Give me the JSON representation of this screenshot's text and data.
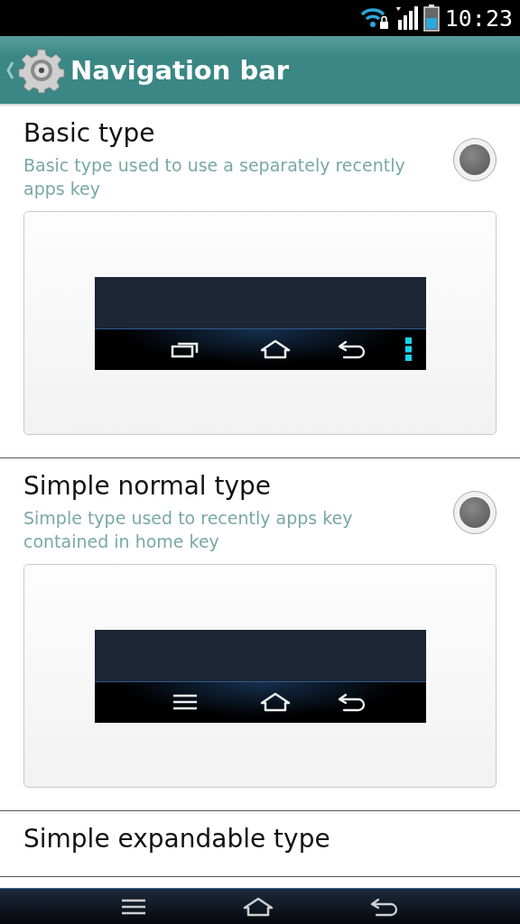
{
  "status_bar": {
    "time": "10:23"
  },
  "action_bar": {
    "title": "Navigation bar"
  },
  "options": [
    {
      "title": "Basic type",
      "description": "Basic type used to use a separately recently apps key",
      "selected": false,
      "preview_keys": [
        {
          "kind": "recent"
        },
        {
          "kind": "home"
        },
        {
          "kind": "back"
        },
        {
          "kind": "overflow"
        }
      ]
    },
    {
      "title": "Simple normal type",
      "description": "Simple type used to recently apps key contained in home key",
      "selected": false,
      "preview_keys": [
        {
          "kind": "menu"
        },
        {
          "kind": "home"
        },
        {
          "kind": "back"
        }
      ]
    },
    {
      "title": "Simple expandable type"
    }
  ],
  "nav_keys": [
    {
      "kind": "menu"
    },
    {
      "kind": "home"
    },
    {
      "kind": "back"
    }
  ]
}
